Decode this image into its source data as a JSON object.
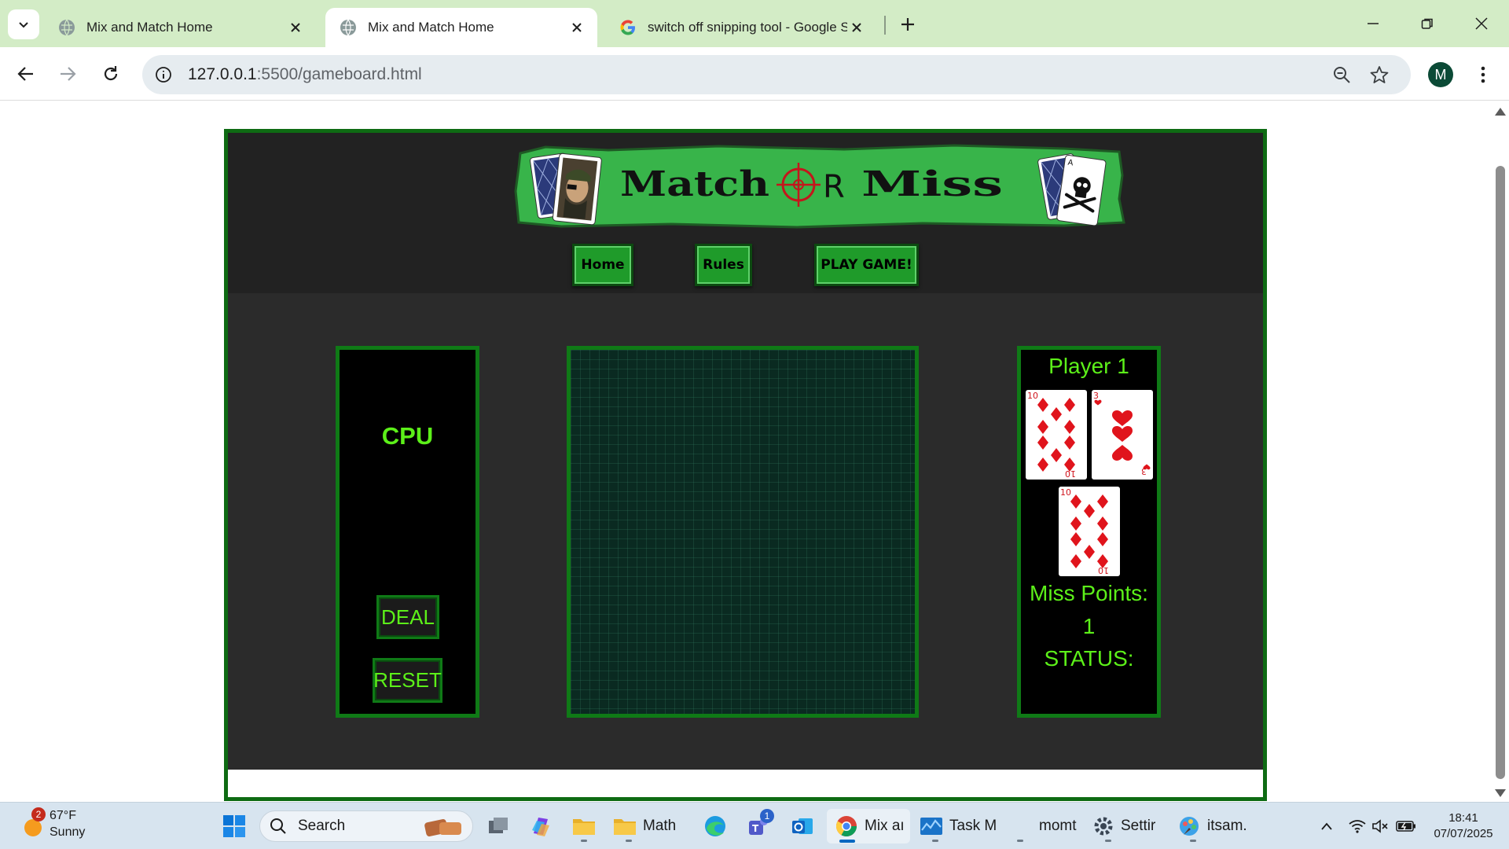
{
  "browser": {
    "tabs": [
      {
        "title": "Mix and Match Home",
        "active": false,
        "favicon": "globe-icon"
      },
      {
        "title": "Mix and Match Home",
        "active": true,
        "favicon": "globe-icon"
      },
      {
        "title": "switch off snipping tool - Google Sear",
        "active": false,
        "favicon": "google-icon"
      }
    ],
    "url_host": "127.0.0.1",
    "url_path": ":5500/gameboard.html",
    "profile_initial": "M"
  },
  "game": {
    "banner_title_left": "Match",
    "banner_title_o": "O",
    "banner_title_r": "R",
    "banner_title_right": "Miss",
    "nav": {
      "home": "Home",
      "rules": "Rules",
      "play": "PLAY GAME!"
    },
    "cpu": {
      "title": "CPU",
      "deal": "DEAL",
      "reset": "RESET"
    },
    "player": {
      "title": "Player 1",
      "cards": [
        {
          "rank": "10",
          "suit": "diamonds"
        },
        {
          "rank": "3",
          "suit": "hearts"
        },
        {
          "rank": "10",
          "suit": "diamonds"
        }
      ],
      "miss_points_label": "Miss Points:",
      "miss_points_value": "1",
      "status_label": "STATUS:"
    },
    "colors": {
      "accent": "#5cf019",
      "border": "#0f7a16",
      "button": "#1f9b2a"
    }
  },
  "taskbar": {
    "weather": {
      "badge": "2",
      "temp": "67°F",
      "condition": "Sunny"
    },
    "search_label": "Search",
    "apps": [
      {
        "name": "task-view",
        "label": ""
      },
      {
        "name": "copilot",
        "label": ""
      },
      {
        "name": "file-explorer",
        "label": ""
      },
      {
        "name": "math-folder",
        "label": "Math"
      },
      {
        "name": "edge",
        "label": ""
      },
      {
        "name": "teams",
        "label": "",
        "badge": "1"
      },
      {
        "name": "outlook",
        "label": ""
      },
      {
        "name": "chrome",
        "label": "Mix aı"
      },
      {
        "name": "task-manager",
        "label": "Task M"
      },
      {
        "name": "moment",
        "label": "momt"
      },
      {
        "name": "settings",
        "label": "Settir"
      },
      {
        "name": "itsam",
        "label": "itsam."
      }
    ],
    "time": "18:41",
    "date": "07/07/2025"
  }
}
